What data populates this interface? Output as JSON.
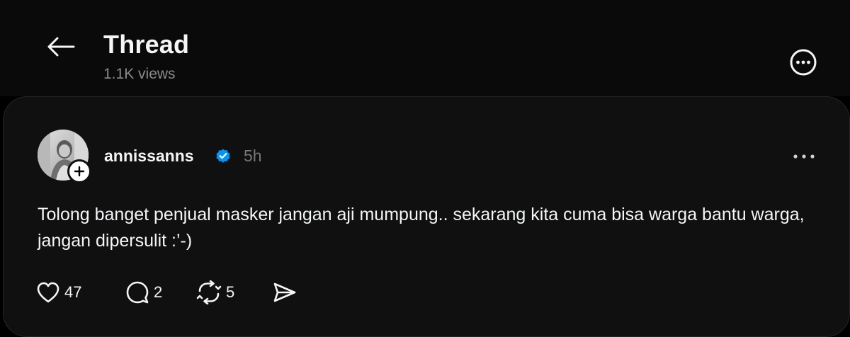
{
  "header": {
    "title": "Thread",
    "views": "1.1K views"
  },
  "post": {
    "username": "annissanns",
    "timestamp": "5h",
    "text": "Tolong banget penjual masker jangan aji mumpung.. sekarang kita cuma bisa warga bantu warga, jangan dipersulit :’-)",
    "verified": true,
    "actions": {
      "likes": "47",
      "replies": "2",
      "reposts": "5"
    }
  },
  "icons": {
    "back": "arrow-left-icon",
    "more_header": "more-circle-icon",
    "more_post": "more-horizontal-icon",
    "follow": "plus-icon",
    "verified": "verified-badge-icon",
    "like": "heart-icon",
    "reply": "comment-icon",
    "repost": "repost-icon",
    "share": "send-icon"
  },
  "colors": {
    "background": "#000000",
    "card": "#101010",
    "text": "#f3f5f7",
    "muted": "#777777",
    "verified": "#0095f6"
  }
}
